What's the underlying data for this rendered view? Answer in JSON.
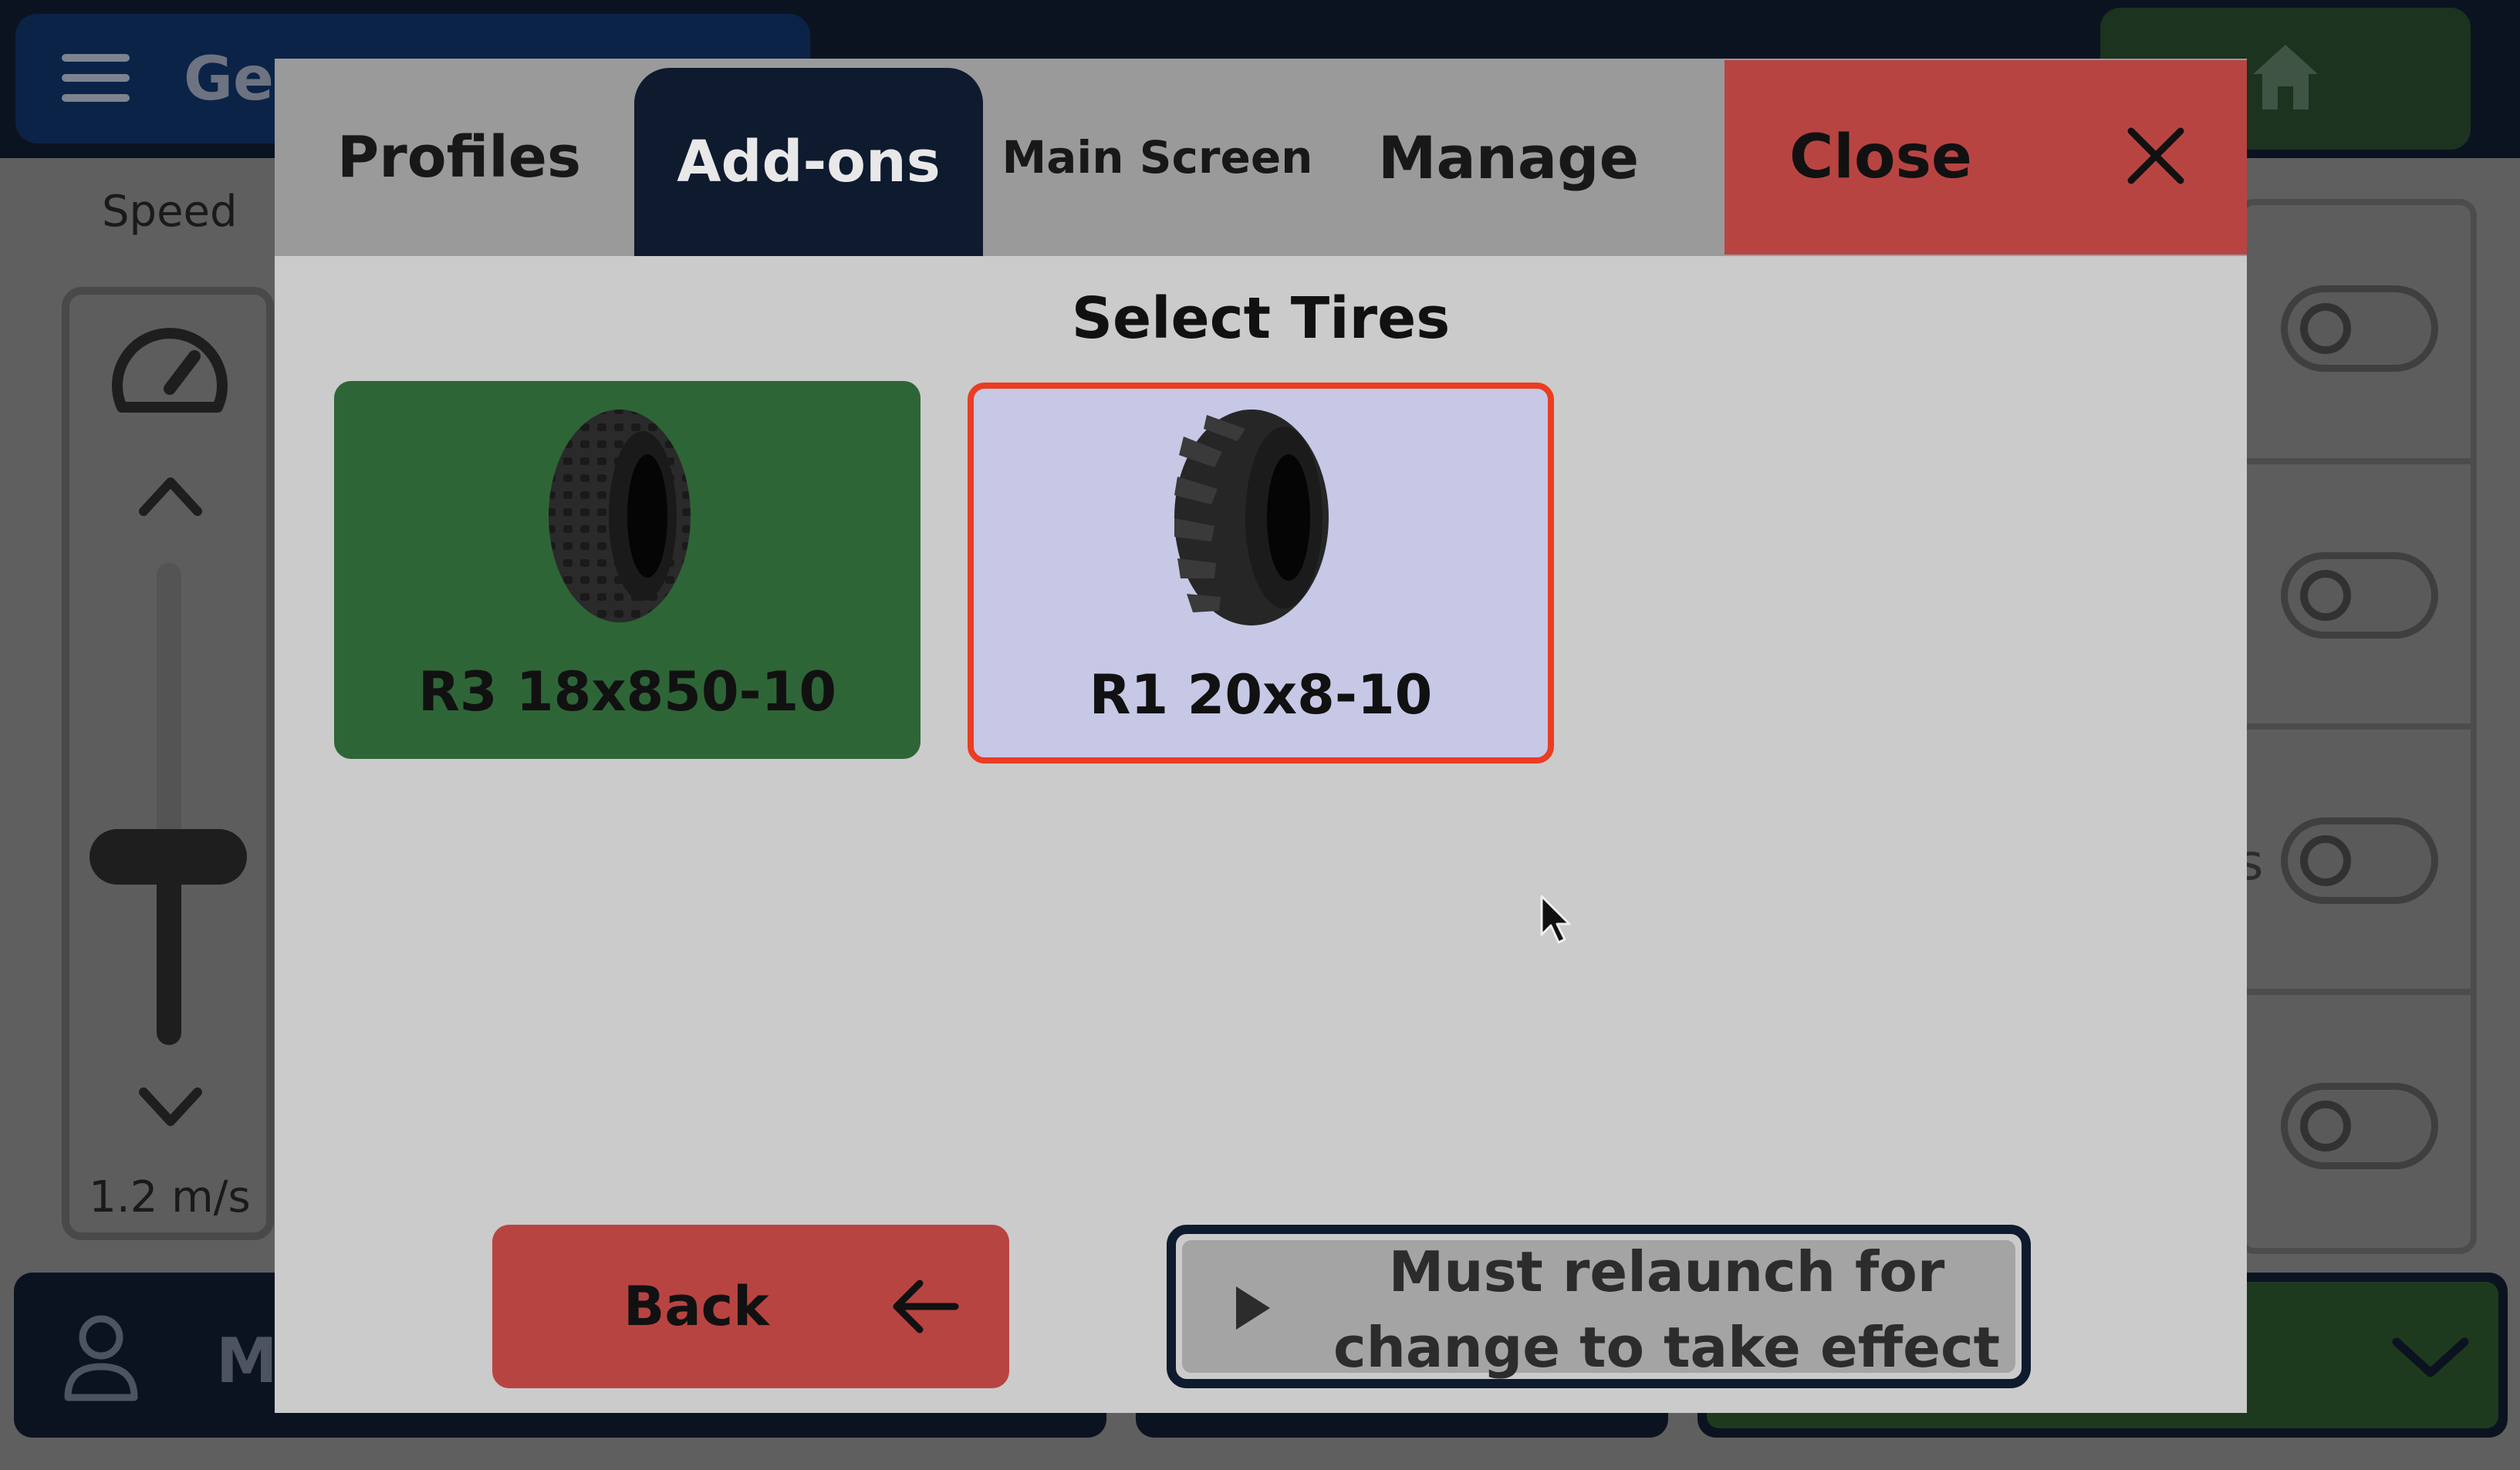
{
  "background": {
    "header_title": "Ger",
    "speed": {
      "label": "Speed",
      "value": "1.2 m/s",
      "slider_level_fraction": 0.35
    },
    "right_panel_partial_text": "s",
    "bottom_bar_partial_text": "M"
  },
  "modal": {
    "tabs": {
      "profiles": "Profiles",
      "addons": "Add-ons",
      "main_screen": "Main Screen",
      "manage": "Manage"
    },
    "active_tab": "Add-ons",
    "close_label": "Close",
    "section_title": "Select Tires",
    "tires": [
      {
        "label": "R3 18x850-10",
        "selected": false,
        "color": "#2e6537"
      },
      {
        "label": "R1 20x8-10",
        "selected": true,
        "color": "#c6c8e6",
        "highlight_color": "#ea3d22"
      }
    ],
    "back_label": "Back",
    "relaunch_message": "Must relaunch for\nchange to take effect"
  },
  "colors": {
    "danger": "#b84442",
    "navy": "#0e1a2e",
    "green": "#2e6537"
  },
  "icons": [
    "menu-icon",
    "home-icon",
    "speedometer-icon",
    "chevron-up-icon",
    "chevron-down-icon",
    "user-icon",
    "close-icon",
    "tire-icon",
    "arrow-left-icon",
    "play-icon",
    "mouse-cursor-icon"
  ]
}
